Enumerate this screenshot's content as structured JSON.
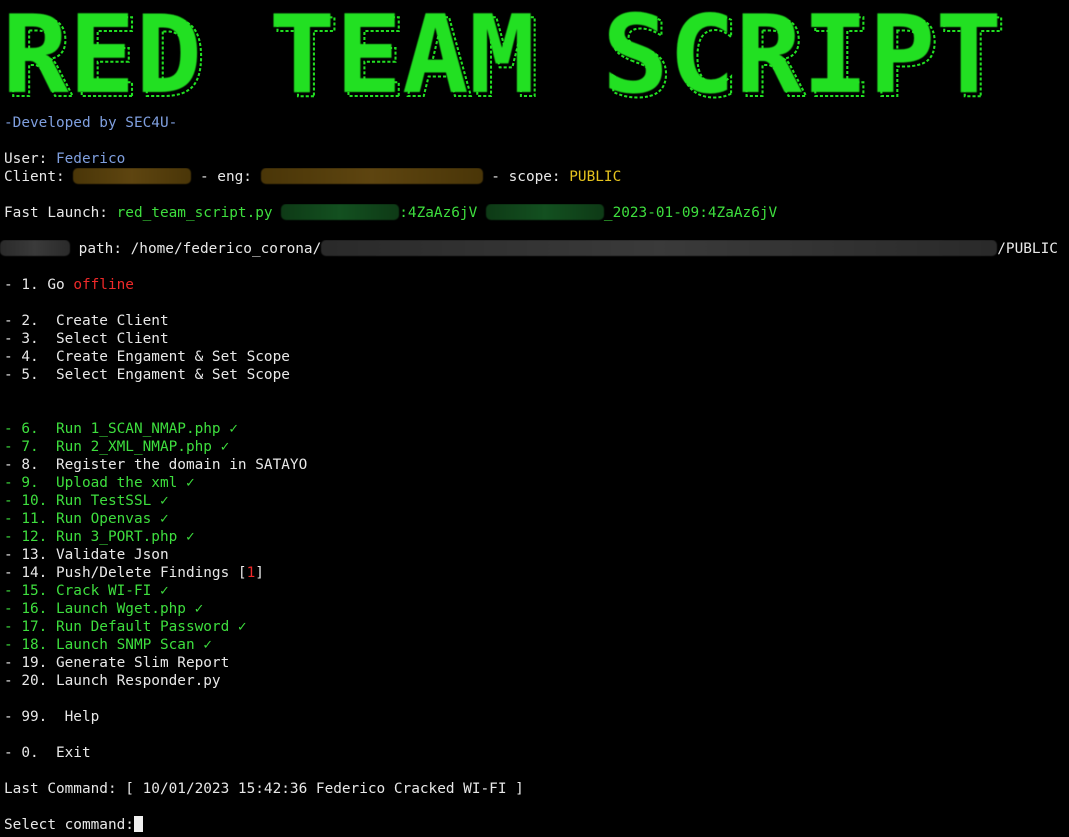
{
  "banner": {
    "text": "RED TEAM SCRIPT",
    "color": "#22e022"
  },
  "developed_by": "-Developed by SEC4U-",
  "user": {
    "label": "User: ",
    "value": "Federico"
  },
  "client": {
    "label": "Client: ",
    "eng_label": " - eng: ",
    "scope_label": " - scope: ",
    "scope_value": "PUBLIC"
  },
  "fast_launch": {
    "label": "Fast Launch: ",
    "script": "red_team_script.py ",
    "suffix1": ":4ZaAz6jV ",
    "suffix2": "_2023-01-09:4ZaAz6jV"
  },
  "path": {
    "label": " path: /home/federico_corona/",
    "suffix": "/PUBLIC"
  },
  "offline_item": {
    "prefix": "- 1. Go ",
    "status": "offline"
  },
  "menu_group_1": [
    {
      "text": "- 2.  Create Client",
      "done": false
    },
    {
      "text": "- 3.  Select Client",
      "done": false
    },
    {
      "text": "- 4.  Create Engament & Set Scope",
      "done": false
    },
    {
      "text": "- 5.  Select Engament & Set Scope",
      "done": false
    }
  ],
  "menu_group_2": [
    {
      "text": "- 6.  Run 1_SCAN_NMAP.php ✓",
      "done": true
    },
    {
      "text": "- 7.  Run 2_XML_NMAP.php ✓",
      "done": true
    },
    {
      "text": "- 8.  Register the domain in SATAYO",
      "done": false
    },
    {
      "text": "- 9.  Upload the xml ✓",
      "done": true
    },
    {
      "text": "- 10. Run TestSSL ✓",
      "done": true
    },
    {
      "text": "- 11. Run Openvas ✓",
      "done": true
    },
    {
      "text": "- 12. Run 3_PORT.php ✓",
      "done": true
    },
    {
      "text": "- 13. Validate Json",
      "done": false
    }
  ],
  "findings_item": {
    "prefix": "- 14. Push/Delete Findings [",
    "count": "1",
    "suffix": "]"
  },
  "menu_group_3": [
    {
      "text": "- 15. Crack WI-FI ✓",
      "done": true
    },
    {
      "text": "- 16. Launch Wget.php ✓",
      "done": true
    },
    {
      "text": "- 17. Run Default Password ✓",
      "done": true
    },
    {
      "text": "- 18. Launch SNMP Scan ✓",
      "done": true
    },
    {
      "text": "- 19. Generate Slim Report",
      "done": false
    },
    {
      "text": "- 20. Launch Responder.py",
      "done": false
    }
  ],
  "help_item": "- 99.  Help",
  "exit_item": "- 0.  Exit",
  "last_command": "Last Command: [ 10/01/2023 15:42:36 Federico Cracked WI-FI ]",
  "prompt": "Select command:",
  "colors": {
    "done": "#3ede3e",
    "accent_blue": "#7f9fdf",
    "scope": "#e6c41e",
    "alert": "#ef2929"
  }
}
